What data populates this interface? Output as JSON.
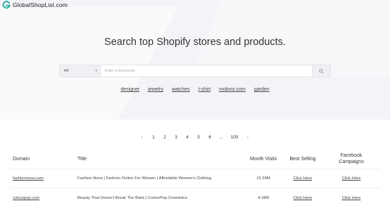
{
  "brand": {
    "name": "GlobalShopList.com",
    "accent": "#2bb3a3"
  },
  "hero": {
    "headline": "Search top Shopify stores and products."
  },
  "search": {
    "category_value": "All",
    "placeholder": "Enter a keywords",
    "button_icon": "search-icon"
  },
  "popular_tags": [
    "designer",
    "jewelry",
    "watches",
    "t-shirt",
    "mobvoi.com",
    "garden"
  ],
  "pagination": {
    "prev": "‹",
    "pages": [
      "1",
      "2",
      "3",
      "4",
      "5",
      "6",
      "...",
      "100"
    ],
    "next": "›"
  },
  "table": {
    "headers": {
      "domain": "Domain",
      "title": "Title",
      "month_visits": "Month Visits",
      "best_selling": "Best Selling",
      "facebook_campaigns": "Facebook Campaigns"
    },
    "rows": [
      {
        "domain": "fashionnova.com",
        "title": "Fashion Nova | Fashion Online For Women | Affordable Women's Clothing",
        "month_visits": "15.34M",
        "best_selling": "Click Here",
        "facebook_campaigns": "Click Here"
      },
      {
        "domain": "colourpop.com",
        "title": "Beauty That Doesn't Break The Bank | ColourPop Cosmetics",
        "month_visits": "4.18M",
        "best_selling": "Click Here",
        "facebook_campaigns": "Click Here"
      }
    ]
  }
}
